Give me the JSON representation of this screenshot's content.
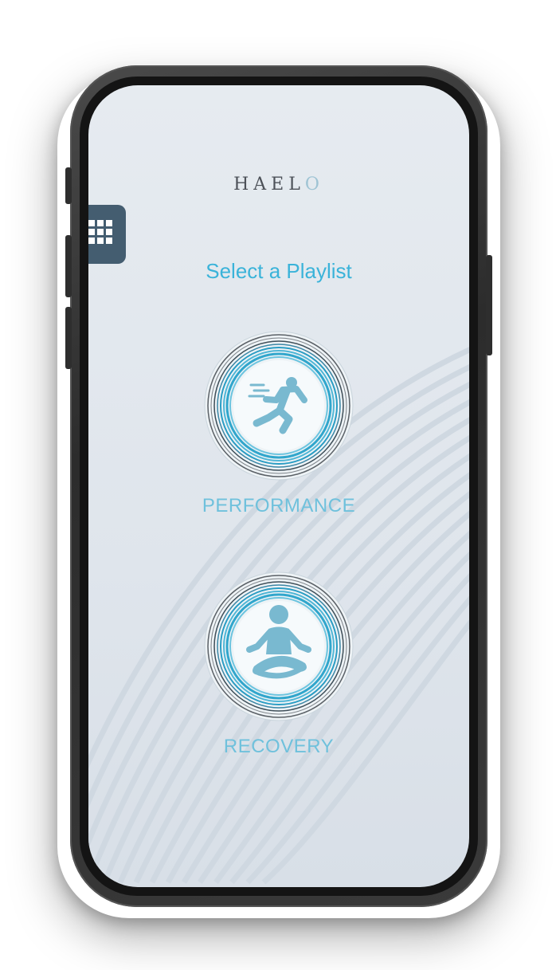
{
  "app": {
    "logo_text_main": "HAEL",
    "logo_text_accent": "O"
  },
  "menu": {
    "icon": "grid-icon"
  },
  "main": {
    "heading": "Select a Playlist",
    "playlists": [
      {
        "label": "PERFORMANCE",
        "icon": "runner-icon"
      },
      {
        "label": "RECOVERY",
        "icon": "meditation-icon"
      }
    ]
  },
  "colors": {
    "accent": "#3ab3d9",
    "label": "#6fc1dc",
    "icon_fill": "#79b9d0",
    "tab_bg": "#445d70",
    "ring": "#2a9dc4"
  }
}
